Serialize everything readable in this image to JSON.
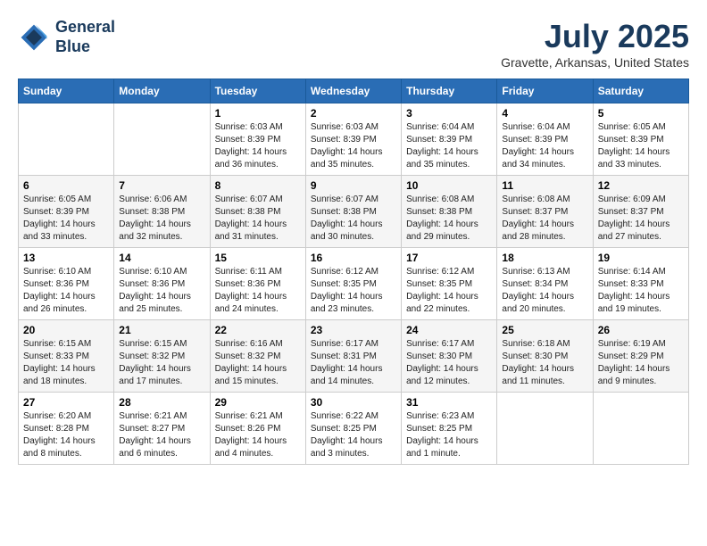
{
  "header": {
    "logo_line1": "General",
    "logo_line2": "Blue",
    "month_year": "July 2025",
    "location": "Gravette, Arkansas, United States"
  },
  "weekdays": [
    "Sunday",
    "Monday",
    "Tuesday",
    "Wednesday",
    "Thursday",
    "Friday",
    "Saturday"
  ],
  "weeks": [
    [
      {
        "day": "",
        "text": ""
      },
      {
        "day": "",
        "text": ""
      },
      {
        "day": "1",
        "text": "Sunrise: 6:03 AM\nSunset: 8:39 PM\nDaylight: 14 hours and 36 minutes."
      },
      {
        "day": "2",
        "text": "Sunrise: 6:03 AM\nSunset: 8:39 PM\nDaylight: 14 hours and 35 minutes."
      },
      {
        "day": "3",
        "text": "Sunrise: 6:04 AM\nSunset: 8:39 PM\nDaylight: 14 hours and 35 minutes."
      },
      {
        "day": "4",
        "text": "Sunrise: 6:04 AM\nSunset: 8:39 PM\nDaylight: 14 hours and 34 minutes."
      },
      {
        "day": "5",
        "text": "Sunrise: 6:05 AM\nSunset: 8:39 PM\nDaylight: 14 hours and 33 minutes."
      }
    ],
    [
      {
        "day": "6",
        "text": "Sunrise: 6:05 AM\nSunset: 8:39 PM\nDaylight: 14 hours and 33 minutes."
      },
      {
        "day": "7",
        "text": "Sunrise: 6:06 AM\nSunset: 8:38 PM\nDaylight: 14 hours and 32 minutes."
      },
      {
        "day": "8",
        "text": "Sunrise: 6:07 AM\nSunset: 8:38 PM\nDaylight: 14 hours and 31 minutes."
      },
      {
        "day": "9",
        "text": "Sunrise: 6:07 AM\nSunset: 8:38 PM\nDaylight: 14 hours and 30 minutes."
      },
      {
        "day": "10",
        "text": "Sunrise: 6:08 AM\nSunset: 8:38 PM\nDaylight: 14 hours and 29 minutes."
      },
      {
        "day": "11",
        "text": "Sunrise: 6:08 AM\nSunset: 8:37 PM\nDaylight: 14 hours and 28 minutes."
      },
      {
        "day": "12",
        "text": "Sunrise: 6:09 AM\nSunset: 8:37 PM\nDaylight: 14 hours and 27 minutes."
      }
    ],
    [
      {
        "day": "13",
        "text": "Sunrise: 6:10 AM\nSunset: 8:36 PM\nDaylight: 14 hours and 26 minutes."
      },
      {
        "day": "14",
        "text": "Sunrise: 6:10 AM\nSunset: 8:36 PM\nDaylight: 14 hours and 25 minutes."
      },
      {
        "day": "15",
        "text": "Sunrise: 6:11 AM\nSunset: 8:36 PM\nDaylight: 14 hours and 24 minutes."
      },
      {
        "day": "16",
        "text": "Sunrise: 6:12 AM\nSunset: 8:35 PM\nDaylight: 14 hours and 23 minutes."
      },
      {
        "day": "17",
        "text": "Sunrise: 6:12 AM\nSunset: 8:35 PM\nDaylight: 14 hours and 22 minutes."
      },
      {
        "day": "18",
        "text": "Sunrise: 6:13 AM\nSunset: 8:34 PM\nDaylight: 14 hours and 20 minutes."
      },
      {
        "day": "19",
        "text": "Sunrise: 6:14 AM\nSunset: 8:33 PM\nDaylight: 14 hours and 19 minutes."
      }
    ],
    [
      {
        "day": "20",
        "text": "Sunrise: 6:15 AM\nSunset: 8:33 PM\nDaylight: 14 hours and 18 minutes."
      },
      {
        "day": "21",
        "text": "Sunrise: 6:15 AM\nSunset: 8:32 PM\nDaylight: 14 hours and 17 minutes."
      },
      {
        "day": "22",
        "text": "Sunrise: 6:16 AM\nSunset: 8:32 PM\nDaylight: 14 hours and 15 minutes."
      },
      {
        "day": "23",
        "text": "Sunrise: 6:17 AM\nSunset: 8:31 PM\nDaylight: 14 hours and 14 minutes."
      },
      {
        "day": "24",
        "text": "Sunrise: 6:17 AM\nSunset: 8:30 PM\nDaylight: 14 hours and 12 minutes."
      },
      {
        "day": "25",
        "text": "Sunrise: 6:18 AM\nSunset: 8:30 PM\nDaylight: 14 hours and 11 minutes."
      },
      {
        "day": "26",
        "text": "Sunrise: 6:19 AM\nSunset: 8:29 PM\nDaylight: 14 hours and 9 minutes."
      }
    ],
    [
      {
        "day": "27",
        "text": "Sunrise: 6:20 AM\nSunset: 8:28 PM\nDaylight: 14 hours and 8 minutes."
      },
      {
        "day": "28",
        "text": "Sunrise: 6:21 AM\nSunset: 8:27 PM\nDaylight: 14 hours and 6 minutes."
      },
      {
        "day": "29",
        "text": "Sunrise: 6:21 AM\nSunset: 8:26 PM\nDaylight: 14 hours and 4 minutes."
      },
      {
        "day": "30",
        "text": "Sunrise: 6:22 AM\nSunset: 8:25 PM\nDaylight: 14 hours and 3 minutes."
      },
      {
        "day": "31",
        "text": "Sunrise: 6:23 AM\nSunset: 8:25 PM\nDaylight: 14 hours and 1 minute."
      },
      {
        "day": "",
        "text": ""
      },
      {
        "day": "",
        "text": ""
      }
    ]
  ]
}
